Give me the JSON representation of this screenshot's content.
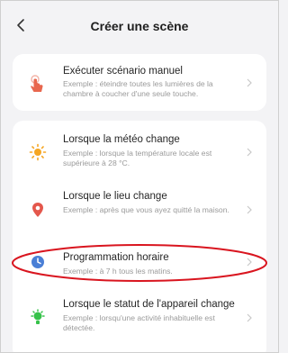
{
  "header": {
    "title": "Créer une scène"
  },
  "manual": {
    "title": "Exécuter scénario manuel",
    "desc": "Exemple : éteindre toutes les lumières de la chambre à coucher d'une seule touche."
  },
  "items": [
    {
      "title": "Lorsque la météo change",
      "desc": "Exemple : lorsque la température locale est supérieure à 28 °C."
    },
    {
      "title": "Lorsque le lieu change",
      "desc": "Exemple : après que vous ayez quitté la maison."
    },
    {
      "title": "Programmation horaire",
      "desc": "Exemple : à 7 h tous les matins."
    },
    {
      "title": "Lorsque le statut de l'appareil change",
      "desc": "Exemple : lorsqu'une activité inhabituelle est détectée."
    }
  ],
  "icons": {
    "back": "chevron-left-icon",
    "manual": "hand-tap-icon",
    "weather": "sun-icon",
    "location": "location-pin-icon",
    "schedule": "clock-icon",
    "device": "device-status-icon",
    "chevron": "chevron-right-icon"
  },
  "colors": {
    "manual_icon": "#e8674e",
    "weather_icon": "#f5a623",
    "location_icon": "#e4574c",
    "schedule_icon": "#4a7fd6",
    "device_icon": "#36c24a",
    "highlight": "#d9151f"
  }
}
